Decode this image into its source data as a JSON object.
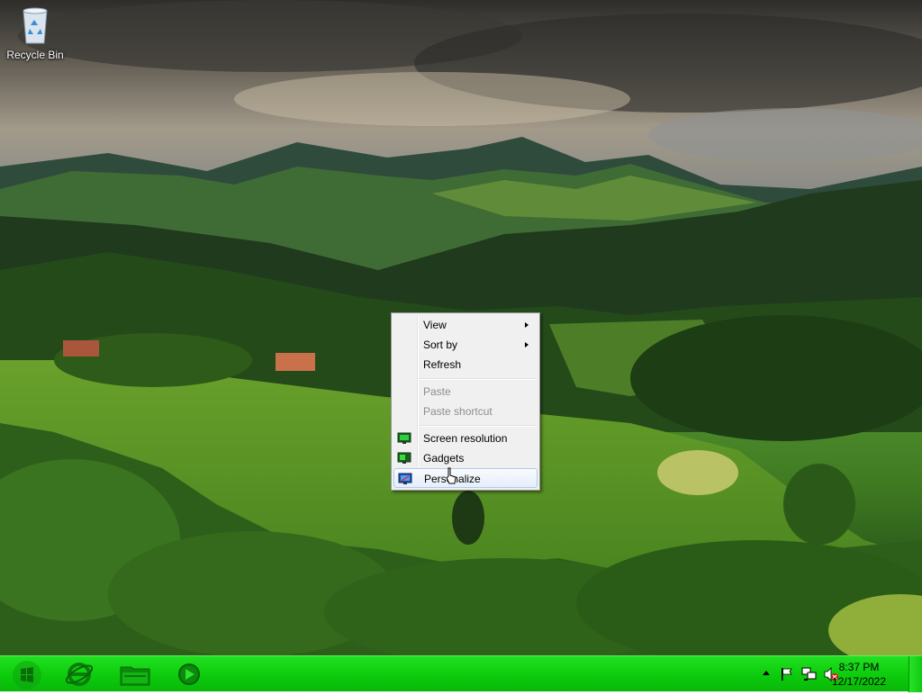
{
  "desktop": {
    "icons": [
      {
        "label": "Recycle Bin",
        "icon": "recycle-bin-icon"
      }
    ]
  },
  "context_menu": {
    "items": [
      {
        "label": "View",
        "submenu": true,
        "enabled": true
      },
      {
        "label": "Sort by",
        "submenu": true,
        "enabled": true
      },
      {
        "label": "Refresh",
        "enabled": true
      },
      {
        "label": "Paste",
        "enabled": false
      },
      {
        "label": "Paste shortcut",
        "enabled": false
      },
      {
        "label": "Screen resolution",
        "icon": "screen-resolution-icon",
        "enabled": true
      },
      {
        "label": "Gadgets",
        "icon": "gadgets-icon",
        "enabled": true
      },
      {
        "label": "Personalize",
        "icon": "personalize-icon",
        "enabled": true,
        "highlighted": true
      }
    ]
  },
  "taskbar": {
    "start_icon": "windows-start-icon",
    "pinned": [
      {
        "icon": "internet-explorer-icon"
      },
      {
        "icon": "file-explorer-icon"
      },
      {
        "icon": "media-player-icon"
      }
    ],
    "tray": {
      "icons": [
        "show-hidden-icons-icon",
        "action-center-flag-icon",
        "network-icon",
        "volume-muted-icon"
      ],
      "time": "8:37 PM",
      "date": "12/17/2022"
    },
    "accent_color": "#14d214"
  }
}
